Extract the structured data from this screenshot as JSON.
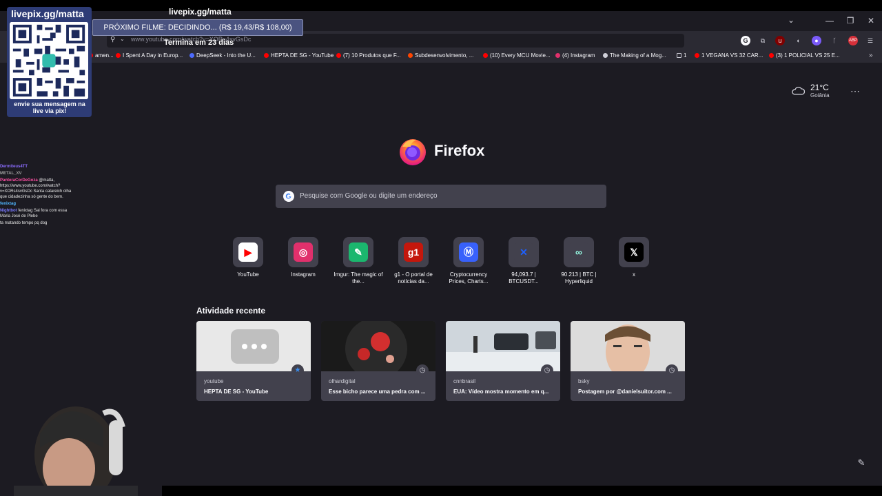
{
  "stream": {
    "handle": "livepix.gg/matta",
    "header": "livepix.gg/matta",
    "qr_caption": "envie sua mensagem na live via pix!",
    "next_movie": "PRÓXIMO FILME: DECIDINDO... (R$ 19,43/R$ 108,00)",
    "deadline": "Termina em 23 dias"
  },
  "browser": {
    "url": "www.youtube.com/watch?v=XORs4svGsDc",
    "bookmarks": [
      {
        "label": "amen...",
        "icon": "youtube-icon"
      },
      {
        "label": "I Spent A Day in Europ...",
        "icon": "youtube-icon"
      },
      {
        "label": "DeepSeek - Into the U...",
        "icon": "deepseek-icon"
      },
      {
        "label": "HEPTA DE SG - YouTube",
        "icon": "youtube-icon"
      },
      {
        "label": "(7) 10 Produtos que F...",
        "icon": "youtube-icon"
      },
      {
        "label": "Subdesenvolvimento, ...",
        "icon": "reddit-icon"
      },
      {
        "label": "(10) Every MCU Movie...",
        "icon": "youtube-icon"
      },
      {
        "label": "(4) Instagram",
        "icon": "instagram-icon"
      },
      {
        "label": "The Making of a Mog...",
        "icon": "web-icon"
      },
      {
        "label": "1",
        "icon": "folder-icon"
      },
      {
        "label": "1 VEGANA VS 32 CAR...",
        "icon": "youtube-icon"
      },
      {
        "label": "(3) 1 POLICIAL VS 25 E...",
        "icon": "youtube-icon"
      }
    ]
  },
  "chat": [
    {
      "user": "Dermiteus4TT",
      "text": "",
      "color": "#8b6cff"
    },
    {
      "user": "METAL_XV",
      "text": "",
      "color": "#9e9e9e"
    },
    {
      "user": "PanteraCorDeGoza",
      "text": "@matta, https://www.youtube.com/watch?v=XORs4svGsDc Santa catareich olha que cidadezinha só gente do bem.",
      "color": "#ff4fa3"
    },
    {
      "user": "fenixtag",
      "text": "",
      "color": "#4fb6ff"
    },
    {
      "user": "Nightbot",
      "text": "fenixtag Sai fora com essa Maria José de Plebe",
      "color": "#7a7aff"
    },
    {
      "user": "",
      "text": "ta matando tempo pq dog",
      "color": "#ff4f4f"
    },
    {
      "user": "",
      "text": "",
      "color": "#888888"
    },
    {
      "user": "",
      "text": "",
      "color": "#ff4f4f"
    },
    {
      "user": "",
      "text": "",
      "color": "#ff4f4f"
    }
  ],
  "weather": {
    "temp": "21°C",
    "city": "Goiânia"
  },
  "newtab": {
    "brand": "Firefox",
    "search_placeholder": "Pesquise com Google ou digite um endereço",
    "recent_title": "Atividade recente"
  },
  "shortcuts": [
    {
      "label": "YouTube",
      "icon": "youtube-icon",
      "bg": "#ffffff",
      "fg": "#ff0000",
      "glyph": "▶"
    },
    {
      "label": "Instagram",
      "icon": "instagram-icon",
      "bg": "#e1306c",
      "fg": "#ffffff",
      "glyph": "◎"
    },
    {
      "label": "Imgur: The magic of the...",
      "icon": "imgur-icon",
      "bg": "#1bb76e",
      "fg": "#ffffff",
      "glyph": "✎"
    },
    {
      "label": "g1 - O portal de notícias da...",
      "icon": "g1-icon",
      "bg": "#c4170c",
      "fg": "#ffffff",
      "glyph": "g1"
    },
    {
      "label": "Cryptocurrency Prices, Charts...",
      "icon": "coinmarketcap-icon",
      "bg": "#3861fb",
      "fg": "#ffffff",
      "glyph": "Ⓜ"
    },
    {
      "label": "94,093.7 | BTCUSDT...",
      "icon": "x-logo-blue-icon",
      "bg": "#42414d",
      "fg": "#1e60ff",
      "glyph": "✕"
    },
    {
      "label": "90.213 | BTC | Hyperliquid",
      "icon": "hyperliquid-icon",
      "bg": "#42414d",
      "fg": "#97fce4",
      "glyph": "∞"
    },
    {
      "label": "x",
      "icon": "x-icon",
      "bg": "#000000",
      "fg": "#ffffff",
      "glyph": "𝕏"
    }
  ],
  "recent": [
    {
      "source": "youtube",
      "title": "HEPTA DE SG - YouTube",
      "badge": "bookmark-star-icon"
    },
    {
      "source": "olhardigital",
      "title": "Esse bicho parece uma pedra com ...",
      "badge": "history-clock-icon"
    },
    {
      "source": "cnnbrasil",
      "title": "EUA: Vídeo mostra momento em q...",
      "badge": "history-clock-icon"
    },
    {
      "source": "bsky",
      "title": "Postagem por @danielsuitor.com ...",
      "badge": "history-clock-icon"
    }
  ]
}
